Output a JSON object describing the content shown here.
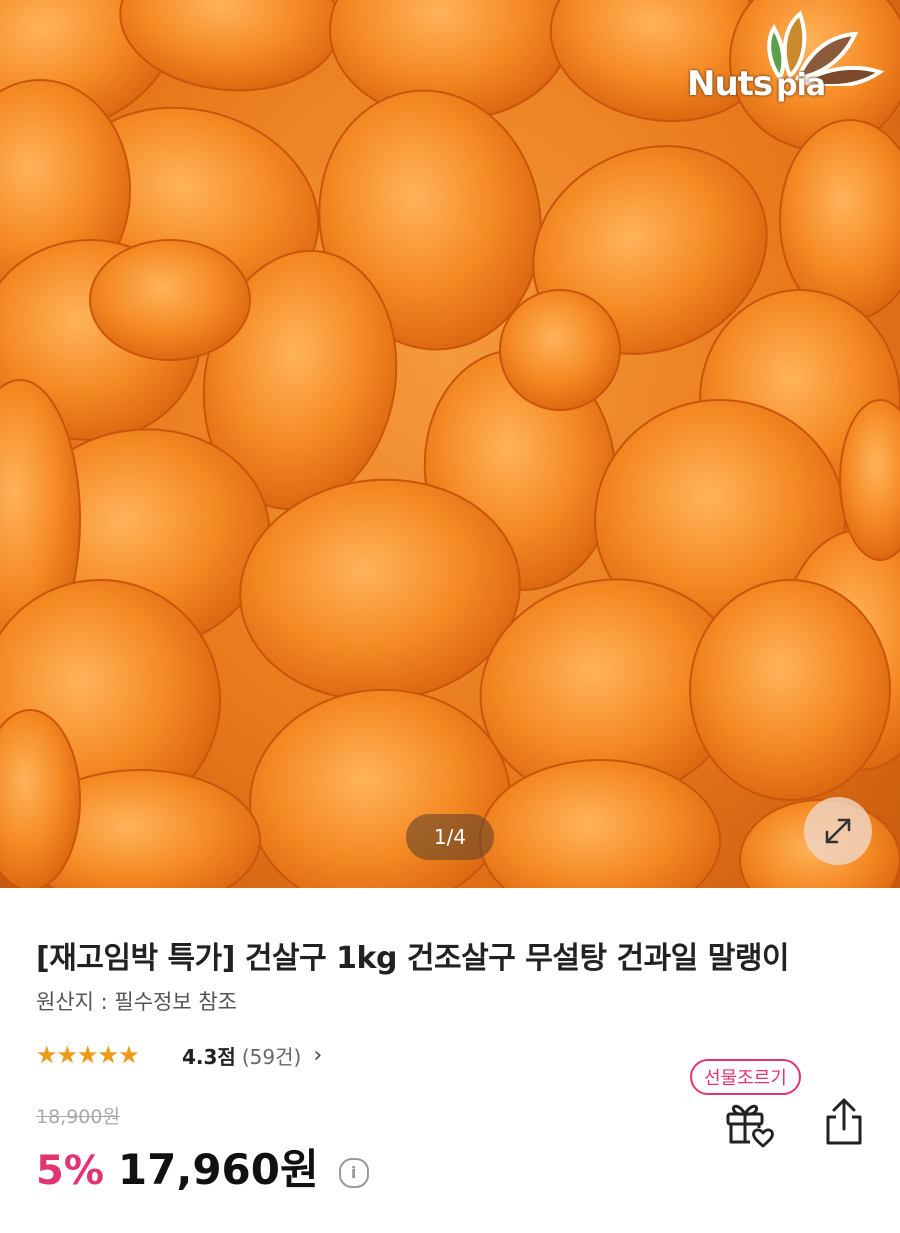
{
  "gallery": {
    "counter": "1/4",
    "brand": {
      "part1": "Nuts",
      "part2": "pia"
    },
    "expand_icon": "expand-arrows-icon"
  },
  "product": {
    "title": "[재고임박 특가] 건살구 1kg 건조살구 무설탕 건과일 말랭이",
    "origin": "원산지 : 필수정보 참조",
    "rating": {
      "value": 4.3,
      "score_label": "4.3점",
      "count_label": "(59건)",
      "stars": "★★★★★"
    },
    "original_price": "18,900원",
    "discount": "5%",
    "sale_price": "17,960원",
    "info_symbol": "i"
  },
  "actions": {
    "gift_badge": "선물조르기",
    "gift_icon": "gift-heart-icon",
    "share_icon": "share-icon"
  },
  "colors": {
    "accent": "#e2346f",
    "star": "#f09a1a",
    "star_empty": "#c9ced6"
  }
}
